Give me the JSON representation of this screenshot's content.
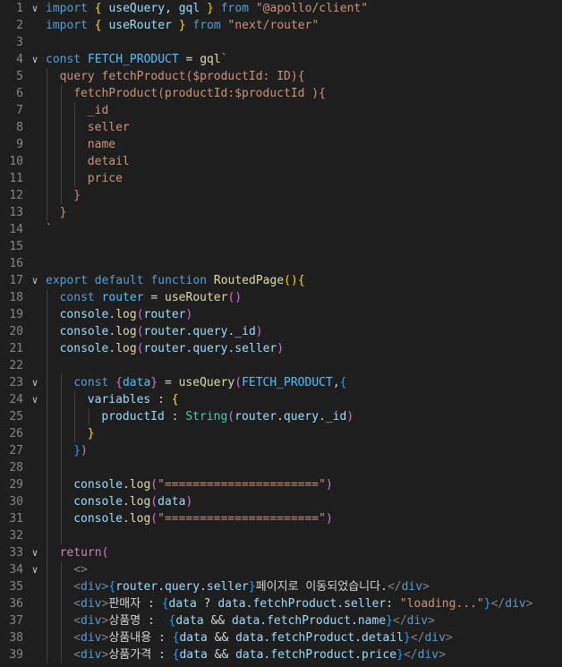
{
  "editor": {
    "language": "javascript",
    "theme": "dark",
    "lines": [
      {
        "n": "1",
        "fold": true,
        "indent": 0,
        "tokens": [
          [
            "kw",
            "import"
          ],
          [
            "ws",
            " "
          ],
          [
            "b1",
            "{"
          ],
          [
            "ws",
            " "
          ],
          [
            "var",
            "useQuery"
          ],
          [
            "ws",
            ", "
          ],
          [
            "var",
            "gql"
          ],
          [
            "ws",
            " "
          ],
          [
            "b1",
            "}"
          ],
          [
            "ws",
            " "
          ],
          [
            "kw",
            "from"
          ],
          [
            "ws",
            " "
          ],
          [
            "str",
            "\"@apollo/client\""
          ]
        ]
      },
      {
        "n": "2",
        "fold": false,
        "indent": 0,
        "tokens": [
          [
            "kw",
            "import"
          ],
          [
            "ws",
            " "
          ],
          [
            "b1",
            "{"
          ],
          [
            "ws",
            " "
          ],
          [
            "var",
            "useRouter"
          ],
          [
            "ws",
            " "
          ],
          [
            "b1",
            "}"
          ],
          [
            "ws",
            " "
          ],
          [
            "kw",
            "from"
          ],
          [
            "ws",
            " "
          ],
          [
            "str",
            "\"next/router\""
          ]
        ]
      },
      {
        "n": "3",
        "fold": false,
        "indent": 0,
        "tokens": []
      },
      {
        "n": "4",
        "fold": true,
        "indent": 0,
        "tokens": [
          [
            "kw",
            "const"
          ],
          [
            "ws",
            " "
          ],
          [
            "cst",
            "FETCH_PRODUCT"
          ],
          [
            "ws",
            " = "
          ],
          [
            "fn",
            "gql"
          ],
          [
            "str",
            "`"
          ]
        ]
      },
      {
        "n": "5",
        "fold": false,
        "indent": 1,
        "tokens": [
          [
            "str",
            "query fetchProduct($productId: ID){"
          ]
        ]
      },
      {
        "n": "6",
        "fold": false,
        "indent": 2,
        "tokens": [
          [
            "str",
            "fetchProduct(productId:$productId ){"
          ]
        ]
      },
      {
        "n": "7",
        "fold": false,
        "indent": 3,
        "tokens": [
          [
            "str",
            "_id"
          ]
        ]
      },
      {
        "n": "8",
        "fold": false,
        "indent": 3,
        "tokens": [
          [
            "str",
            "seller"
          ]
        ]
      },
      {
        "n": "9",
        "fold": false,
        "indent": 3,
        "tokens": [
          [
            "str",
            "name"
          ]
        ]
      },
      {
        "n": "10",
        "fold": false,
        "indent": 3,
        "tokens": [
          [
            "str",
            "detail"
          ]
        ]
      },
      {
        "n": "11",
        "fold": false,
        "indent": 3,
        "tokens": [
          [
            "str",
            "price"
          ]
        ]
      },
      {
        "n": "12",
        "fold": false,
        "indent": 2,
        "tokens": [
          [
            "str",
            "}"
          ]
        ]
      },
      {
        "n": "13",
        "fold": false,
        "indent": 1,
        "tokens": [
          [
            "str",
            "}"
          ]
        ]
      },
      {
        "n": "14",
        "fold": false,
        "indent": 0,
        "tokens": [
          [
            "str",
            "`"
          ]
        ]
      },
      {
        "n": "15",
        "fold": false,
        "indent": 0,
        "tokens": []
      },
      {
        "n": "16",
        "fold": false,
        "indent": 0,
        "tokens": []
      },
      {
        "n": "17",
        "fold": true,
        "indent": 0,
        "tokens": [
          [
            "kw",
            "export"
          ],
          [
            "ws",
            " "
          ],
          [
            "kw",
            "default"
          ],
          [
            "ws",
            " "
          ],
          [
            "kw",
            "function"
          ],
          [
            "ws",
            " "
          ],
          [
            "fn",
            "RoutedPage"
          ],
          [
            "b1",
            "()"
          ],
          [
            "b1",
            "{"
          ]
        ]
      },
      {
        "n": "18",
        "fold": false,
        "indent": 1,
        "tokens": [
          [
            "kw",
            "const"
          ],
          [
            "ws",
            " "
          ],
          [
            "cst",
            "router"
          ],
          [
            "ws",
            " = "
          ],
          [
            "fn",
            "useRouter"
          ],
          [
            "b2",
            "()"
          ]
        ]
      },
      {
        "n": "19",
        "fold": false,
        "indent": 1,
        "tokens": [
          [
            "var",
            "console"
          ],
          [
            "ws",
            "."
          ],
          [
            "fn",
            "log"
          ],
          [
            "b2",
            "("
          ],
          [
            "var",
            "router"
          ],
          [
            "b2",
            ")"
          ]
        ]
      },
      {
        "n": "20",
        "fold": false,
        "indent": 1,
        "tokens": [
          [
            "var",
            "console"
          ],
          [
            "ws",
            "."
          ],
          [
            "fn",
            "log"
          ],
          [
            "b2",
            "("
          ],
          [
            "var",
            "router"
          ],
          [
            "ws",
            "."
          ],
          [
            "var",
            "query"
          ],
          [
            "ws",
            "."
          ],
          [
            "var",
            "_id"
          ],
          [
            "b2",
            ")"
          ]
        ]
      },
      {
        "n": "21",
        "fold": false,
        "indent": 1,
        "tokens": [
          [
            "var",
            "console"
          ],
          [
            "ws",
            "."
          ],
          [
            "fn",
            "log"
          ],
          [
            "b2",
            "("
          ],
          [
            "var",
            "router"
          ],
          [
            "ws",
            "."
          ],
          [
            "var",
            "query"
          ],
          [
            "ws",
            "."
          ],
          [
            "var",
            "seller"
          ],
          [
            "b2",
            ")"
          ]
        ]
      },
      {
        "n": "22",
        "fold": false,
        "indent": 1,
        "tokens": []
      },
      {
        "n": "23",
        "fold": true,
        "indent": 2,
        "tokens": [
          [
            "kw",
            "const"
          ],
          [
            "ws",
            " "
          ],
          [
            "b2",
            "{"
          ],
          [
            "cst",
            "data"
          ],
          [
            "b2",
            "}"
          ],
          [
            "ws",
            " = "
          ],
          [
            "fn",
            "useQuery"
          ],
          [
            "b2",
            "("
          ],
          [
            "cst",
            "FETCH_PRODUCT"
          ],
          [
            "ws",
            ","
          ],
          [
            "b3",
            "{"
          ]
        ]
      },
      {
        "n": "24",
        "fold": true,
        "indent": 3,
        "tokens": [
          [
            "var",
            "variables"
          ],
          [
            "ws",
            " : "
          ],
          [
            "b1",
            "{"
          ]
        ]
      },
      {
        "n": "25",
        "fold": false,
        "indent": 4,
        "tokens": [
          [
            "var",
            "productId"
          ],
          [
            "ws",
            " : "
          ],
          [
            "type",
            "String"
          ],
          [
            "b2",
            "("
          ],
          [
            "var",
            "router"
          ],
          [
            "ws",
            "."
          ],
          [
            "var",
            "query"
          ],
          [
            "ws",
            "."
          ],
          [
            "var",
            "_id"
          ],
          [
            "b2",
            ")"
          ]
        ]
      },
      {
        "n": "26",
        "fold": false,
        "indent": 3,
        "tokens": [
          [
            "b1",
            "}"
          ]
        ]
      },
      {
        "n": "27",
        "fold": false,
        "indent": 2,
        "tokens": [
          [
            "b3",
            "}"
          ],
          [
            "b2",
            ")"
          ]
        ]
      },
      {
        "n": "28",
        "fold": false,
        "indent": 2,
        "tokens": []
      },
      {
        "n": "29",
        "fold": false,
        "indent": 2,
        "tokens": [
          [
            "var",
            "console"
          ],
          [
            "ws",
            "."
          ],
          [
            "fn",
            "log"
          ],
          [
            "b2",
            "("
          ],
          [
            "str",
            "\"======================\""
          ],
          [
            "b2",
            ")"
          ]
        ]
      },
      {
        "n": "30",
        "fold": false,
        "indent": 2,
        "tokens": [
          [
            "var",
            "console"
          ],
          [
            "ws",
            "."
          ],
          [
            "fn",
            "log"
          ],
          [
            "b2",
            "("
          ],
          [
            "var",
            "data"
          ],
          [
            "b2",
            ")"
          ]
        ]
      },
      {
        "n": "31",
        "fold": false,
        "indent": 2,
        "tokens": [
          [
            "var",
            "console"
          ],
          [
            "ws",
            "."
          ],
          [
            "fn",
            "log"
          ],
          [
            "b2",
            "("
          ],
          [
            "str",
            "\"======================\""
          ],
          [
            "b2",
            ")"
          ]
        ]
      },
      {
        "n": "32",
        "fold": false,
        "indent": 2,
        "tokens": []
      },
      {
        "n": "33",
        "fold": true,
        "indent": 1,
        "tokens": [
          [
            "ctl",
            "return"
          ],
          [
            "b2",
            "("
          ]
        ]
      },
      {
        "n": "34",
        "fold": true,
        "indent": 2,
        "tokens": [
          [
            "tag",
            "<>"
          ]
        ]
      },
      {
        "n": "35",
        "fold": false,
        "indent": 2,
        "tokens": [
          [
            "tag",
            "<"
          ],
          [
            "tn",
            "div"
          ],
          [
            "tag",
            ">"
          ],
          [
            "b3",
            "{"
          ],
          [
            "var",
            "router"
          ],
          [
            "ws",
            "."
          ],
          [
            "var",
            "query"
          ],
          [
            "ws",
            "."
          ],
          [
            "var",
            "seller"
          ],
          [
            "b3",
            "}"
          ],
          [
            "txt",
            "페이지로 이동되었습니다."
          ],
          [
            "tag",
            "</"
          ],
          [
            "tn",
            "div"
          ],
          [
            "tag",
            ">"
          ]
        ]
      },
      {
        "n": "36",
        "fold": false,
        "indent": 2,
        "tokens": [
          [
            "tag",
            "<"
          ],
          [
            "tn",
            "div"
          ],
          [
            "tag",
            ">"
          ],
          [
            "txt",
            "판매자 : "
          ],
          [
            "b3",
            "{"
          ],
          [
            "var",
            "data"
          ],
          [
            "ws",
            " ? "
          ],
          [
            "var",
            "data"
          ],
          [
            "ws",
            "."
          ],
          [
            "var",
            "fetchProduct"
          ],
          [
            "ws",
            "."
          ],
          [
            "var",
            "seller"
          ],
          [
            "ws",
            ": "
          ],
          [
            "str",
            "\"loading...\""
          ],
          [
            "b3",
            "}"
          ],
          [
            "tag",
            "</"
          ],
          [
            "tn",
            "div"
          ],
          [
            "tag",
            ">"
          ]
        ]
      },
      {
        "n": "37",
        "fold": false,
        "indent": 2,
        "tokens": [
          [
            "tag",
            "<"
          ],
          [
            "tn",
            "div"
          ],
          [
            "tag",
            ">"
          ],
          [
            "txt",
            "상품명 :  "
          ],
          [
            "b3",
            "{"
          ],
          [
            "var",
            "data"
          ],
          [
            "ws",
            " && "
          ],
          [
            "var",
            "data"
          ],
          [
            "ws",
            "."
          ],
          [
            "var",
            "fetchProduct"
          ],
          [
            "ws",
            "."
          ],
          [
            "var",
            "name"
          ],
          [
            "b3",
            "}"
          ],
          [
            "tag",
            "</"
          ],
          [
            "tn",
            "div"
          ],
          [
            "tag",
            ">"
          ]
        ]
      },
      {
        "n": "38",
        "fold": false,
        "indent": 2,
        "tokens": [
          [
            "tag",
            "<"
          ],
          [
            "tn",
            "div"
          ],
          [
            "tag",
            ">"
          ],
          [
            "txt",
            "상품내용 : "
          ],
          [
            "b3",
            "{"
          ],
          [
            "var",
            "data"
          ],
          [
            "ws",
            " && "
          ],
          [
            "var",
            "data"
          ],
          [
            "ws",
            "."
          ],
          [
            "var",
            "fetchProduct"
          ],
          [
            "ws",
            "."
          ],
          [
            "var",
            "detail"
          ],
          [
            "b3",
            "}"
          ],
          [
            "tag",
            "</"
          ],
          [
            "tn",
            "div"
          ],
          [
            "tag",
            ">"
          ]
        ]
      },
      {
        "n": "39",
        "fold": false,
        "indent": 2,
        "tokens": [
          [
            "tag",
            "<"
          ],
          [
            "tn",
            "div"
          ],
          [
            "tag",
            ">"
          ],
          [
            "txt",
            "상품가격 : "
          ],
          [
            "b3",
            "{"
          ],
          [
            "var",
            "data"
          ],
          [
            "ws",
            " && "
          ],
          [
            "var",
            "data"
          ],
          [
            "ws",
            "."
          ],
          [
            "var",
            "fetchProduct"
          ],
          [
            "ws",
            "."
          ],
          [
            "var",
            "price"
          ],
          [
            "b3",
            "}"
          ],
          [
            "tag",
            "</"
          ],
          [
            "tn",
            "div"
          ],
          [
            "tag",
            ">"
          ]
        ]
      }
    ]
  }
}
